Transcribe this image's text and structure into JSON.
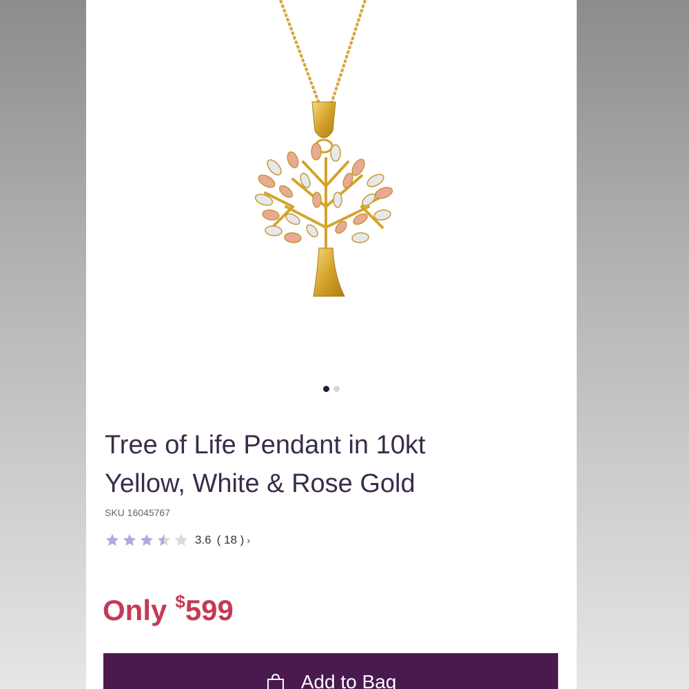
{
  "product": {
    "image_alt": "Tree of Life pendant on a gold chain",
    "title_line1": "Tree of Life Pendant in 10kt",
    "title_line2": "Yellow, White & Rose Gold",
    "sku": "SKU 16045767",
    "rating": {
      "stars_filled_fraction": 0.72,
      "value": "3.6",
      "count": "( 18 )",
      "chevron": "›"
    },
    "price": {
      "prefix": "Only",
      "currency": "$",
      "amount": "599"
    },
    "add_to_bag_label": "Add to Bag"
  },
  "carousel": {
    "total_images": 2,
    "active_index": 0
  },
  "colors": {
    "star_filled": "#b7a6df",
    "star_empty": "#d9d9d9",
    "price": "#c43a56",
    "button": "#4a1a4f",
    "title": "#3b2b4a"
  },
  "icons": {
    "bag": "shopping-bag-icon",
    "star": "star-icon"
  }
}
